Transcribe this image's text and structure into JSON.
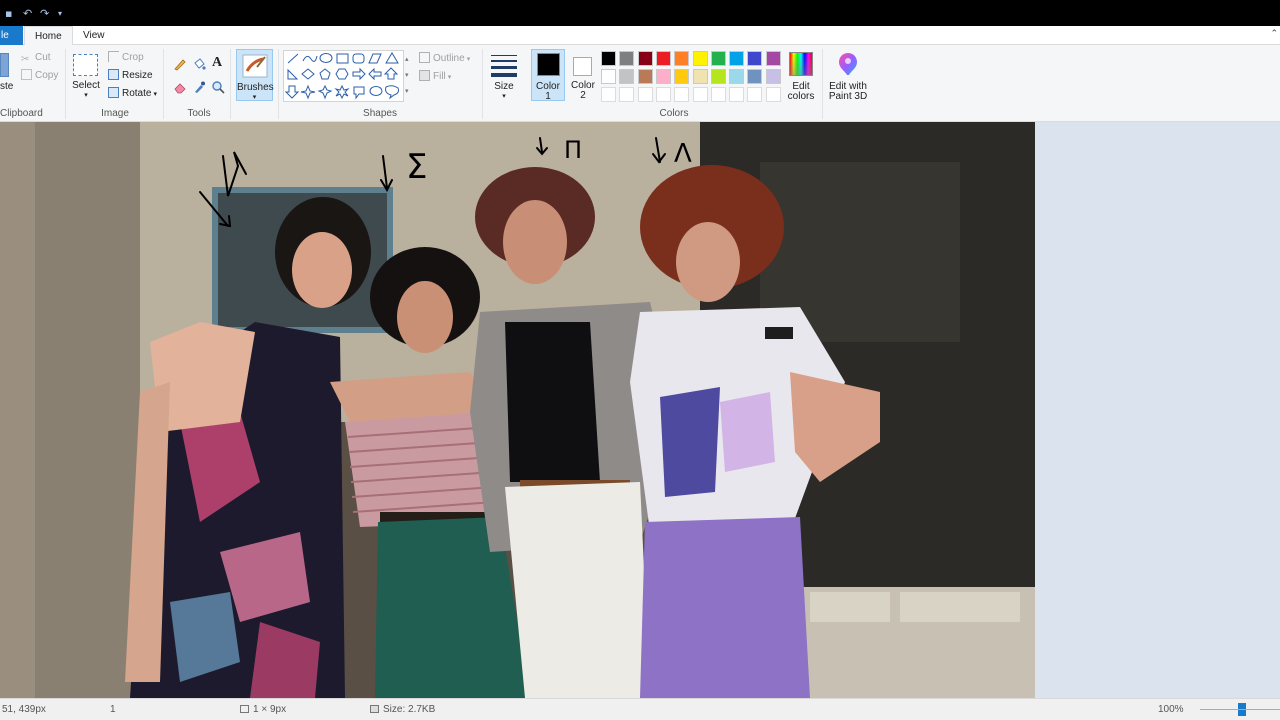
{
  "tabs": {
    "file": "le",
    "home": "Home",
    "view": "View"
  },
  "clipboard": {
    "paste": "ste",
    "cut": "Cut",
    "copy": "Copy",
    "label": "Clipboard"
  },
  "image": {
    "select": "Select",
    "crop": "Crop",
    "resize": "Resize",
    "rotate": "Rotate",
    "label": "Image"
  },
  "tools": {
    "label": "Tools"
  },
  "brushes": {
    "label": "Brushes"
  },
  "shapes": {
    "outline": "Outline",
    "fill": "Fill",
    "label": "Shapes"
  },
  "size": {
    "label": "Size"
  },
  "color1": {
    "line1": "Color",
    "line2": "1"
  },
  "color2": {
    "line1": "Color",
    "line2": "2"
  },
  "colors": {
    "label": "Colors",
    "row1": [
      "#000000",
      "#7f7f7f",
      "#880015",
      "#ed1c24",
      "#ff7f27",
      "#fff200",
      "#22b14c",
      "#00a2e8",
      "#3f48cc",
      "#a349a4"
    ],
    "row2": [
      "#ffffff",
      "#c3c3c3",
      "#b97a57",
      "#ffaec9",
      "#ffc90e",
      "#efe4b0",
      "#b5e61d",
      "#99d9ea",
      "#7092be",
      "#c8bfe7"
    ]
  },
  "edit_colors": {
    "line1": "Edit",
    "line2": "colors"
  },
  "paint3d": {
    "line1": "Edit with",
    "line2": "Paint 3D"
  },
  "annotations": [
    "Σ",
    "Π",
    "Λ"
  ],
  "status": {
    "position": "51, 439px",
    "selection": "1",
    "dimensions": "1 × 9px",
    "filesize": "Size: 2.7KB",
    "zoom": "100%"
  }
}
